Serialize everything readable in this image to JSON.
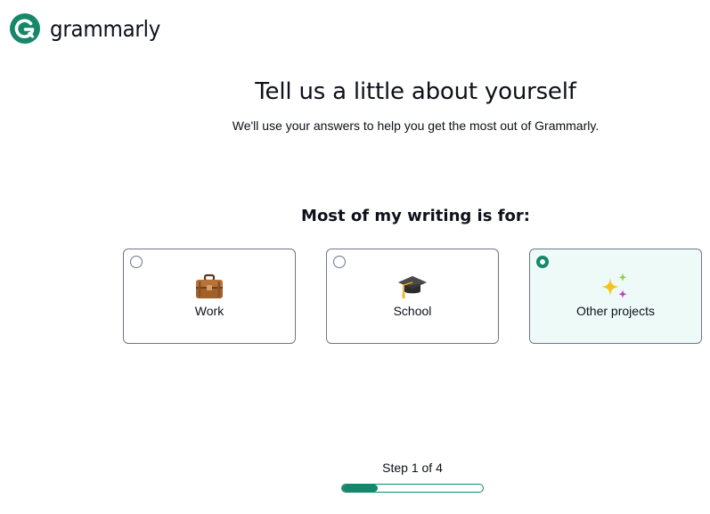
{
  "brand": {
    "name": "grammarly",
    "color": "#15876b"
  },
  "header": {
    "title": "Tell us a little about yourself",
    "subtitle": "We'll use your answers to help you get the most out of Grammarly."
  },
  "question": {
    "label": "Most of my writing is for:",
    "options": [
      {
        "label": "Work",
        "icon": "briefcase-icon",
        "selected": false
      },
      {
        "label": "School",
        "icon": "graduation-cap-icon",
        "selected": false
      },
      {
        "label": "Other projects",
        "icon": "sparkles-icon",
        "selected": true
      }
    ]
  },
  "progress": {
    "label": "Step 1 of 4",
    "current_step": 1,
    "total_steps": 4,
    "fraction": 0.25
  },
  "colors": {
    "accent": "#15876b",
    "selected_background": "#eefaf8",
    "border": "#6d758d",
    "text": "#0e101a"
  }
}
